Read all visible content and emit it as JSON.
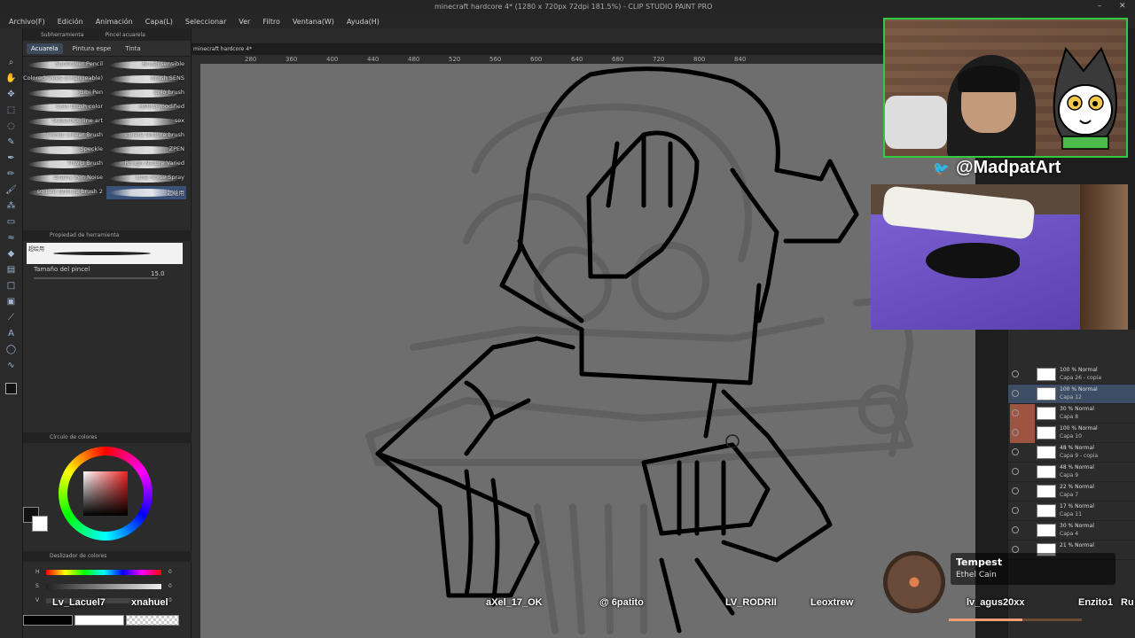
{
  "app": {
    "title": "minecraft hardcore 4* (1280 x 720px 72dpi 181.5%) - CLIP STUDIO PAINT PRO",
    "doc_tab": "minecraft hardcore 4*"
  },
  "menu": [
    "Archivo(F)",
    "Edición",
    "Animación",
    "Capa(L)",
    "Seleccionar",
    "Ver",
    "Filtro",
    "Ventana(W)",
    "Ayuda(H)"
  ],
  "brush_panel": {
    "header": [
      "Subherramienta",
      "Pincel acuarela"
    ],
    "tabs": [
      "Acuarela",
      "Pintura espe",
      "Tinta"
    ],
    "brushes": [
      [
        "Sunflower Pencil",
        "Brush sensible"
      ],
      [
        "Colored Trees (Changeable)",
        "brush SENS"
      ],
      [
        "Bibi Pen",
        "Colo brush"
      ],
      [
        "Colo brush color",
        "HMGG modified"
      ],
      [
        "Subsubue line art",
        "sex"
      ],
      [
        "Comic Linear Brush",
        "square texture brush"
      ],
      [
        "Speckle",
        "ZPEN"
      ],
      [
        "Thwip Brush",
        "Rough Nature Varied"
      ],
      [
        "Grainy Pen Noise",
        "Line Noise Spray"
      ],
      [
        "square texture brush 2",
        "超绘用"
      ]
    ],
    "selected_brush": "超绘用"
  },
  "tool_property": {
    "header": "Propiedad de herramienta",
    "preview_label": "超绘用",
    "brush_size_label": "Tamaño del pincel",
    "brush_size_value": "15.0"
  },
  "color_panel": {
    "header": "Círculo de colores",
    "main_color": "#111111",
    "sub_color": "#ffffff"
  },
  "color_slider": {
    "header": "Deslizador de colores",
    "labels": [
      "H",
      "S",
      "V"
    ],
    "values": [
      "0",
      "0",
      "0"
    ]
  },
  "ruler_ticks": [
    "280",
    "360",
    "400",
    "440",
    "480",
    "520",
    "560",
    "600",
    "640",
    "680",
    "720",
    "800",
    "840"
  ],
  "layers": [
    {
      "pct": "100 % Normal",
      "name": "Capa 26 - copia"
    },
    {
      "pct": "100 % Normal",
      "name": "Capa 12"
    },
    {
      "pct": "30 % Normal",
      "name": "Capa 8"
    },
    {
      "pct": "100 % Normal",
      "name": "Capa 10"
    },
    {
      "pct": "48 % Normal",
      "name": "Capa 9 - copia"
    },
    {
      "pct": "48 % Normal",
      "name": "Capa 9"
    },
    {
      "pct": "22 % Normal",
      "name": "Capa 7"
    },
    {
      "pct": "17 % Normal",
      "name": "Capa 11"
    },
    {
      "pct": "30 % Normal",
      "name": "Capa 4"
    },
    {
      "pct": "21 % Normal",
      "name": ""
    }
  ],
  "stream": {
    "handle": "@MadpatArt",
    "chatters": [
      "Lv_Lacuel7",
      "xnahuel",
      "aXel_17_OK",
      "@ 6patito",
      "LV_RODRII",
      "Leoxtrew",
      "lv_agus20xx",
      "Enzito1",
      "Ru"
    ],
    "now_playing": {
      "title": "Tempest",
      "artist": "Ethel Cain",
      "progress": 0.55
    }
  },
  "colors": {
    "accent_green": "#2ecc40",
    "twitter_blue": "#1da1f2"
  }
}
